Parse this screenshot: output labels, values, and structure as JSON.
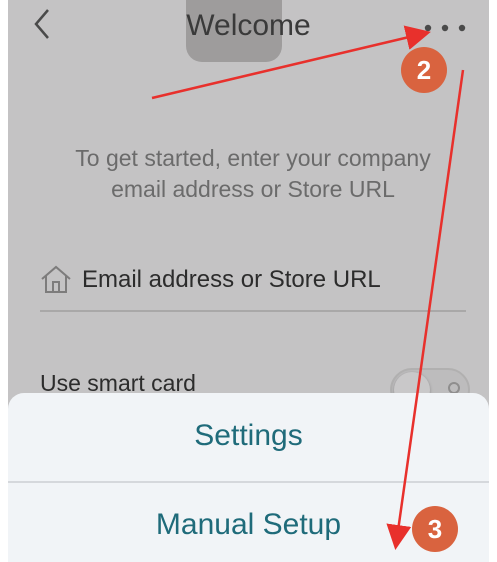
{
  "nav": {
    "title": "Welcome",
    "back_icon": "chevron-left-icon",
    "more_icon": "ellipsis-icon"
  },
  "intro": {
    "text": "To get started, enter your company\nemail address or Store URL"
  },
  "email_field": {
    "icon": "home-icon",
    "placeholder": "Email address or Store URL"
  },
  "smart_card": {
    "label": "Use smart card",
    "enabled": false
  },
  "action_sheet": {
    "items": [
      {
        "label": "Settings"
      },
      {
        "label": "Manual Setup"
      }
    ]
  },
  "annotations": {
    "steps": [
      "2",
      "3"
    ],
    "arrow_color": "#e8302c",
    "badge_color": "#d9633f"
  },
  "colors": {
    "dim_background": "#c4c3c4",
    "sheet_background": "#f1f4f7",
    "sheet_text": "#1f6b7a"
  }
}
